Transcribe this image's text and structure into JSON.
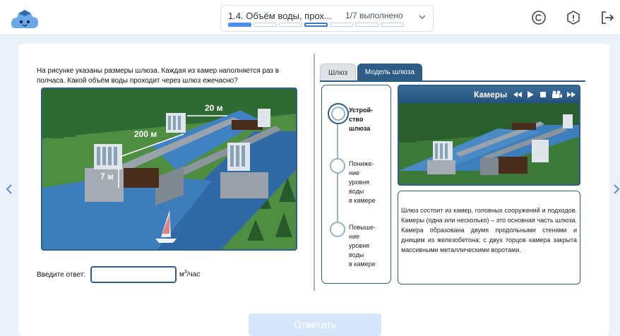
{
  "header": {
    "lesson_title": "1.4. Объём воды, прох...",
    "progress_text": "1/7 выполнено",
    "progress_total": 7,
    "progress_done": 1
  },
  "question": {
    "text": "На рисунке указаны размеры шлюза. Каждая из камер наполняется раз в полчаса. Какой объём воды проходит через шлюз ежечасно?",
    "image_labels": {
      "width": "20 м",
      "length": "200 м",
      "depth": "7 м"
    }
  },
  "answer": {
    "label": "Введите ответ:",
    "value": "",
    "placeholder": "",
    "unit_base": "м",
    "unit_sup": "3",
    "unit_tail": "/час"
  },
  "tabs": [
    {
      "label": "Шлюз",
      "active": false
    },
    {
      "label": "Модель шлюза",
      "active": true
    }
  ],
  "steps": [
    {
      "label": "Устрой-\nство\nшлюза",
      "active": true
    },
    {
      "label": "Пониже-\nние\nуровня\nводы\nв камере",
      "active": false
    },
    {
      "label": "Повыше-\nние\nуровня\nводы\nв камере",
      "active": false
    }
  ],
  "video": {
    "title": "Камеры",
    "controls": [
      "rewind-icon",
      "play-icon",
      "stop-icon",
      "camera-icon",
      "fast-forward-icon"
    ]
  },
  "description": "Шлюз состоит из камер, головных сооружений и подходов. Камеры (одна или несколько) – это основная часть шлюза. Камера образована двумя продольными стенами и днищем из железобетона; с двух торцов камера закрыта массивными металлическими воротами.",
  "submit_label": "Ответить",
  "colors": {
    "accent": "#2d5d87",
    "progress": "#4a8ff0",
    "submit_disabled": "#d7e7fb",
    "background": "#ebf1f8"
  },
  "icons": {
    "logo": "cloud-mascot-logo",
    "copyright": "copyright-icon",
    "report": "alert-icon",
    "exit": "exit-icon",
    "prev": "chevron-left-icon",
    "next": "chevron-right-icon"
  }
}
